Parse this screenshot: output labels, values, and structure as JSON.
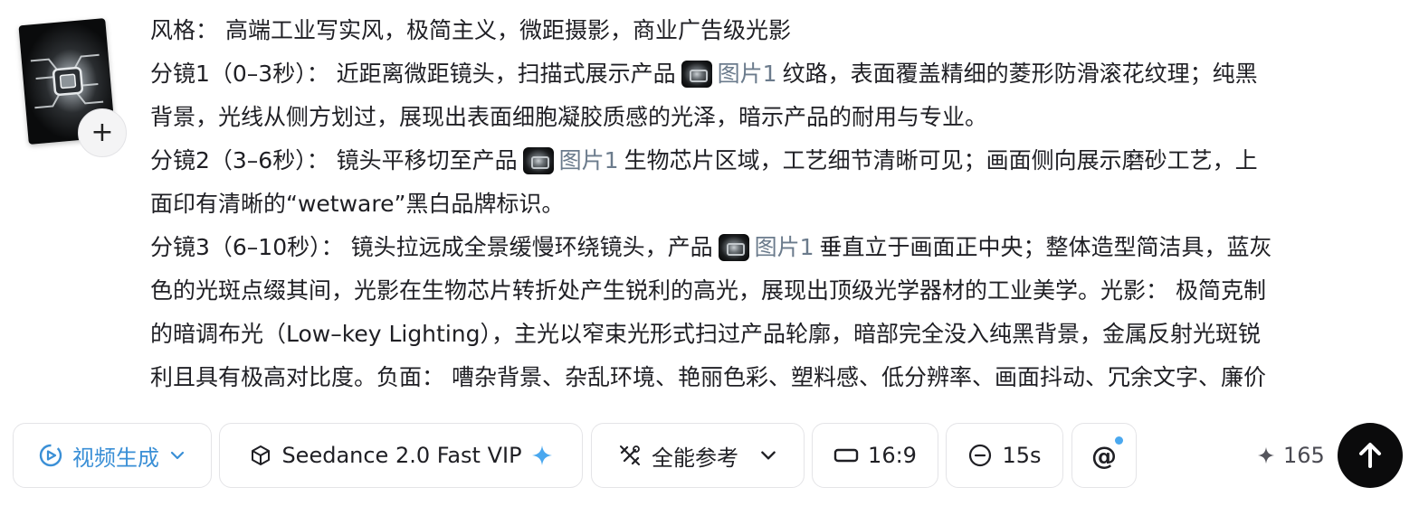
{
  "prompt": {
    "lines": [
      {
        "text": "风格： 高端工业写实风，极简主义，微距摄影，商业广告级光影"
      },
      {
        "before": "分镜1（0–3秒）： 近距离微距镜头，扫描式展示产品",
        "ref": "图片1",
        "after": "纹路，表面覆盖精细的菱形防滑滚花纹理；纯黑"
      },
      {
        "text": "背景，光线从侧方划过，展现出表面细胞凝胶质感的光泽，暗示产品的耐用与专业。"
      },
      {
        "before": "分镜2（3–6秒）： 镜头平移切至产品",
        "ref": "图片1",
        "after": "生物芯片区域，工艺细节清晰可见；画面侧向展示磨砂工艺，上"
      },
      {
        "text": "面印有清晰的“wetware”黑白品牌标识。"
      },
      {
        "before": "分镜3（6–10秒）： 镜头拉远成全景缓慢环绕镜头，产品",
        "ref": "图片1",
        "after": "垂直立于画面正中央；整体造型简洁具，蓝灰"
      },
      {
        "text": "色的光斑点缀其间，光影在生物芯片转折处产生锐利的高光，展现出顶级光学器材的工业美学。光影： 极简克制"
      },
      {
        "text": "的暗调布光（Low–key Lighting），主光以窄束光形式扫过产品轮廓，暗部完全没入纯黑背景，金属反射光斑锐"
      },
      {
        "text": "利且具有极高对比度。负面： 嘈杂背景、杂乱环境、艳丽色彩、塑料感、低分辨率、画面抖动、冗余文字、廉价"
      }
    ]
  },
  "thumbnail": {
    "add_label": "+"
  },
  "toolbar": {
    "mode_label": "视频生成",
    "model_label": "Seedance 2.0 Fast VIP",
    "reference_label": "全能参考",
    "ratio_label": "16:9",
    "duration_label": "15s",
    "mention_label": "@",
    "credits": "165"
  },
  "colors": {
    "accent": "#3a8fd6",
    "ref_text": "#6b7b8c",
    "send_bg": "#0b0b0c"
  }
}
